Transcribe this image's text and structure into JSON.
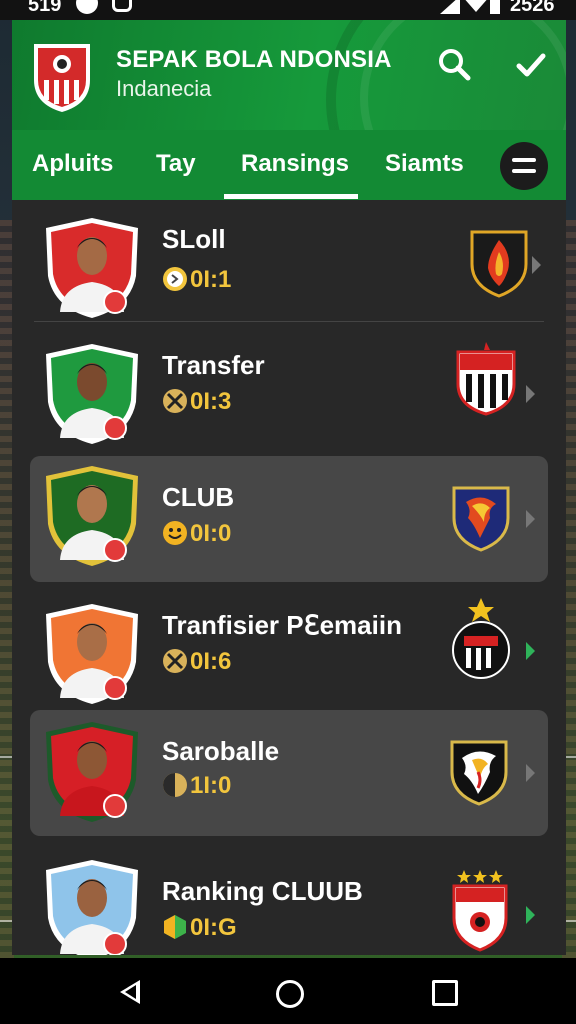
{
  "status_bar": {
    "time": "519",
    "right_text": "2526"
  },
  "header": {
    "title": "SEPAK BOLA NDONSIA",
    "subtitle": "Indanecia"
  },
  "tabs": [
    {
      "label": "Apluits",
      "active": false
    },
    {
      "label": "Tay",
      "active": false
    },
    {
      "label": "Ransings",
      "active": true
    },
    {
      "label": "Siamts",
      "active": false
    }
  ],
  "list": [
    {
      "title": "SLoll",
      "score": "0I:1",
      "score_icon": "clock-icon",
      "highlight": false,
      "shield_color": "#d92b2b",
      "club_icon": "flame-crest-icon"
    },
    {
      "title": "Transfer",
      "score": "0I:3",
      "score_icon": "ball-icon",
      "highlight": false,
      "shield_color": "#1f9a3f",
      "club_icon": "striped-crest-icon"
    },
    {
      "title": "CLUB",
      "score": "0I:0",
      "score_icon": "smile-icon",
      "highlight": true,
      "shield_color": "#1e6b23",
      "club_icon": "phoenix-crest-icon"
    },
    {
      "title": "Tranfisier Pℇemaiin",
      "score": "0I:6",
      "score_icon": "ball-icon",
      "highlight": false,
      "shield_color": "#f07534",
      "club_icon": "star-crest-icon"
    },
    {
      "title": "Saroballe",
      "score": "1I:0",
      "score_icon": "ball-icon",
      "highlight": true,
      "shield_color": "#d61f26",
      "club_icon": "eagle-crest-icon"
    },
    {
      "title": "Ranking CLUUB",
      "score": "0I:G",
      "score_icon": "hexagon-icon",
      "highlight": false,
      "shield_color": "#8fc4ea",
      "club_icon": "stars-crest-icon"
    }
  ],
  "colors": {
    "brand_green": "#169a3b",
    "score_gold": "#f2c53d",
    "background_dark": "#282828"
  }
}
